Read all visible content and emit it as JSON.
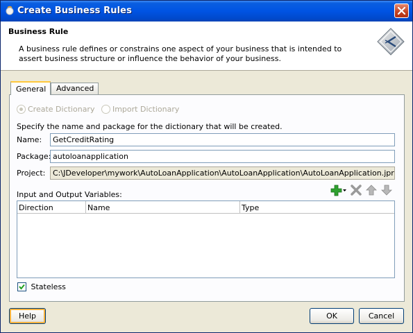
{
  "window": {
    "title": "Create Business Rules"
  },
  "header": {
    "title": "Business Rule",
    "description": "A business rule defines or constrains one aspect of your business that is intended to assert business structure or influence the behavior of your business."
  },
  "tabs": [
    {
      "label": "General",
      "active": true
    },
    {
      "label": "Advanced",
      "active": false
    }
  ],
  "dictionary_options": [
    {
      "label": "Create Dictionary",
      "selected": true,
      "enabled": false
    },
    {
      "label": "Import Dictionary",
      "selected": false,
      "enabled": false
    }
  ],
  "instructions": "Specify the name and package for the dictionary that will be created.",
  "fields": {
    "name": {
      "label": "Name:",
      "value": "GetCreditRating"
    },
    "package": {
      "label": "Package:",
      "value": "autoloanapplication"
    },
    "project": {
      "label": "Project:",
      "value": "C:\\JDeveloper\\mywork\\AutoLoanApplication\\AutoLoanApplication\\AutoLoanApplication.jpr"
    }
  },
  "variables": {
    "label": "Input and Output Variables:",
    "columns": [
      "Direction",
      "Name",
      "Type"
    ],
    "rows": []
  },
  "stateless": {
    "label": "Stateless",
    "checked": true
  },
  "buttons": {
    "help": "Help",
    "ok": "OK",
    "cancel": "Cancel"
  },
  "icons": {
    "title": "oracle-jdev-icon",
    "header_logo": "business-rule-icon",
    "add": "add-plus-icon",
    "delete": "delete-x-icon",
    "up": "move-up-icon",
    "down": "move-down-icon",
    "close": "close-icon"
  },
  "colors": {
    "titlebar": "#0054e3",
    "dialog_bg": "#ece9d8",
    "add_green": "#2fa12f",
    "focus": "#f8b33e"
  }
}
